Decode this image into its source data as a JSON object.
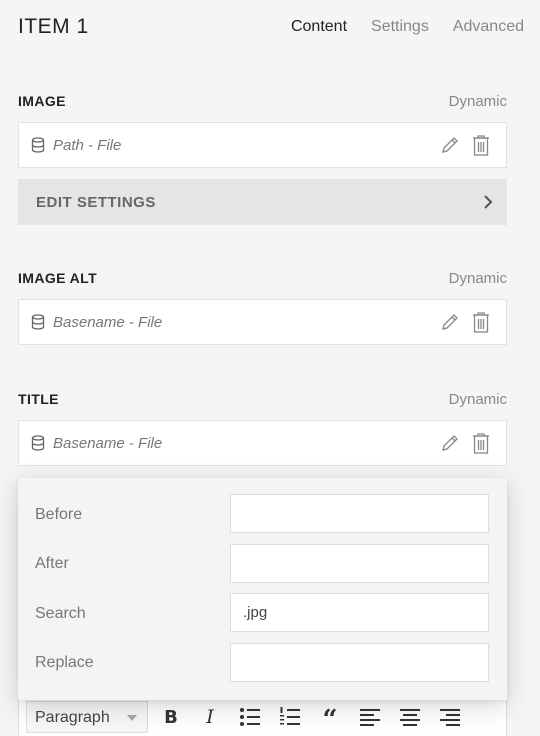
{
  "header": {
    "title": "ITEM 1",
    "tabs": [
      {
        "label": "Content",
        "active": true
      },
      {
        "label": "Settings",
        "active": false
      },
      {
        "label": "Advanced",
        "active": false
      }
    ]
  },
  "sections": {
    "image": {
      "label": "IMAGE",
      "dynamic_label": "Dynamic",
      "value": "Path - File"
    },
    "edit_settings": {
      "label": "EDIT SETTINGS"
    },
    "image_alt": {
      "label": "IMAGE ALT",
      "dynamic_label": "Dynamic",
      "value": "Basename - File"
    },
    "title": {
      "label": "TITLE",
      "dynamic_label": "Dynamic",
      "value": "Basename - File"
    }
  },
  "popup": {
    "before": {
      "label": "Before",
      "value": ""
    },
    "after": {
      "label": "After",
      "value": ""
    },
    "search": {
      "label": "Search",
      "value": ".jpg"
    },
    "replace": {
      "label": "Replace",
      "value": ""
    }
  },
  "toolbar": {
    "format_value": "Paragraph",
    "buttons": {
      "bold": "B",
      "italic": "I",
      "quote": "“"
    }
  },
  "icons": {
    "database": "database-icon",
    "edit": "pencil-icon",
    "delete": "trash-icon",
    "chevron": "chevron-right-icon"
  },
  "colors": {
    "background": "#f5f5f5",
    "field_bg": "#ffffff",
    "button_bg": "#e5e5e5",
    "muted_text": "#888888"
  }
}
